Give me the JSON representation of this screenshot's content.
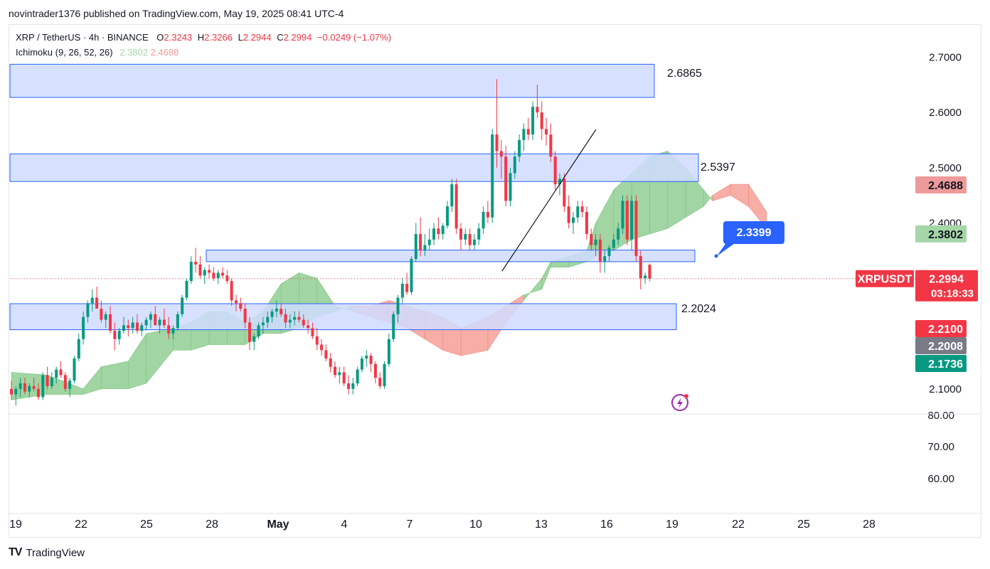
{
  "publish_line": "novintrader1376 published on TradingView.com, May 19, 2025 08:41 UTC-4",
  "symbol": {
    "name": "XRP / TetherUS · 4h · BINANCE",
    "o_label": "O",
    "o": "2.3243",
    "h_label": "H",
    "h": "2.3266",
    "l_label": "L",
    "l": "2.2944",
    "c_label": "C",
    "c": "2.2994",
    "change": "−0.0249 (−1.07%)"
  },
  "indicator": {
    "name": "Ichimoku (9, 26, 52, 26)",
    "value1": "2.3802",
    "value2": "2.4688"
  },
  "logo": {
    "mark": "TV",
    "name": "TradingView"
  },
  "colors": {
    "up": "#089981",
    "down": "#f23645",
    "zone_fill": "#d0dcff",
    "zone_border": "#2962ff",
    "cloud_bull": "#81c784",
    "cloud_bear": "#f28b82",
    "callout": "#2962ff"
  },
  "chart_data": {
    "type": "candlestick",
    "x_ticks": [
      "19",
      "22",
      "25",
      "28",
      "May",
      "4",
      "7",
      "10",
      "13",
      "16",
      "19",
      "22",
      "25",
      "28"
    ],
    "y_ticks": [
      "2.7000",
      "2.6000",
      "2.5000",
      "2.4000",
      "2.1000"
    ],
    "y_ticks_lower": [
      "80.00",
      "70.00",
      "60.00"
    ],
    "ylim": [
      2.05,
      2.74
    ],
    "resistance_zones": [
      {
        "low": 2.627,
        "high": 2.687,
        "label": "2.6865"
      },
      {
        "low": 2.475,
        "high": 2.525,
        "label": "2.5397"
      },
      {
        "low": 2.33,
        "high": 2.351
      },
      {
        "low": 2.207,
        "high": 2.254,
        "label": "2.2024"
      }
    ],
    "callout_label": "2.3399",
    "price_labels": [
      {
        "value": 2.4688,
        "text": "2.4688",
        "bg": "#ef9a9a",
        "fg": "#131722"
      },
      {
        "value": 2.3802,
        "text": "2.3802",
        "bg": "#a5d6a7",
        "fg": "#131722"
      },
      {
        "value": 2.2994,
        "text": "2.2994",
        "sub": "03:18:33",
        "bg": "#f23645",
        "fg": "#ffffff",
        "ticker": "XRPUSDT"
      },
      {
        "value": 2.21,
        "text": "2.2100",
        "bg": "#f23645",
        "fg": "#ffffff"
      },
      {
        "value": 2.2008,
        "text": "2.2008",
        "bg": "#787b86",
        "fg": "#ffffff"
      },
      {
        "value": 2.1736,
        "text": "2.1736",
        "bg": "#089981",
        "fg": "#ffffff"
      }
    ],
    "last_price": 2.2994,
    "ohlc": [
      [
        2.1,
        2.115,
        2.08,
        2.09
      ],
      [
        2.09,
        2.105,
        2.07,
        2.1
      ],
      [
        2.1,
        2.12,
        2.085,
        2.11
      ],
      [
        2.11,
        2.12,
        2.09,
        2.095
      ],
      [
        2.095,
        2.11,
        2.085,
        2.105
      ],
      [
        2.105,
        2.12,
        2.095,
        2.1
      ],
      [
        2.1,
        2.11,
        2.08,
        2.085
      ],
      [
        2.085,
        2.13,
        2.08,
        2.125
      ],
      [
        2.125,
        2.14,
        2.1,
        2.105
      ],
      [
        2.105,
        2.13,
        2.1,
        2.12
      ],
      [
        2.12,
        2.14,
        2.11,
        2.135
      ],
      [
        2.135,
        2.15,
        2.12,
        2.125
      ],
      [
        2.125,
        2.13,
        2.095,
        2.1
      ],
      [
        2.1,
        2.12,
        2.085,
        2.115
      ],
      [
        2.115,
        2.16,
        2.11,
        2.155
      ],
      [
        2.155,
        2.2,
        2.15,
        2.19
      ],
      [
        2.19,
        2.24,
        2.18,
        2.23
      ],
      [
        2.23,
        2.26,
        2.22,
        2.255
      ],
      [
        2.255,
        2.28,
        2.24,
        2.265
      ],
      [
        2.265,
        2.285,
        2.25,
        2.245
      ],
      [
        2.245,
        2.26,
        2.22,
        2.225
      ],
      [
        2.225,
        2.24,
        2.21,
        2.235
      ],
      [
        2.235,
        2.25,
        2.2,
        2.205
      ],
      [
        2.205,
        2.22,
        2.17,
        2.19
      ],
      [
        2.19,
        2.21,
        2.18,
        2.205
      ],
      [
        2.205,
        2.23,
        2.2,
        2.215
      ],
      [
        2.215,
        2.225,
        2.195,
        2.21
      ],
      [
        2.21,
        2.23,
        2.2,
        2.22
      ],
      [
        2.22,
        2.235,
        2.2,
        2.205
      ],
      [
        2.205,
        2.22,
        2.195,
        2.215
      ],
      [
        2.215,
        2.23,
        2.205,
        2.225
      ],
      [
        2.225,
        2.24,
        2.21,
        2.235
      ],
      [
        2.235,
        2.25,
        2.22,
        2.215
      ],
      [
        2.215,
        2.23,
        2.2,
        2.225
      ],
      [
        2.225,
        2.245,
        2.21,
        2.215
      ],
      [
        2.215,
        2.23,
        2.19,
        2.2
      ],
      [
        2.2,
        2.215,
        2.19,
        2.21
      ],
      [
        2.21,
        2.24,
        2.205,
        2.235
      ],
      [
        2.235,
        2.27,
        2.23,
        2.265
      ],
      [
        2.265,
        2.3,
        2.26,
        2.295
      ],
      [
        2.295,
        2.34,
        2.29,
        2.33
      ],
      [
        2.33,
        2.355,
        2.31,
        2.325
      ],
      [
        2.325,
        2.34,
        2.3,
        2.305
      ],
      [
        2.305,
        2.32,
        2.29,
        2.315
      ],
      [
        2.315,
        2.325,
        2.3,
        2.31
      ],
      [
        2.31,
        2.32,
        2.295,
        2.3
      ],
      [
        2.3,
        2.315,
        2.29,
        2.31
      ],
      [
        2.31,
        2.32,
        2.3,
        2.305
      ],
      [
        2.305,
        2.315,
        2.29,
        2.295
      ],
      [
        2.295,
        2.3,
        2.25,
        2.26
      ],
      [
        2.26,
        2.27,
        2.24,
        2.255
      ],
      [
        2.255,
        2.265,
        2.24,
        2.245
      ],
      [
        2.245,
        2.255,
        2.21,
        2.22
      ],
      [
        2.22,
        2.23,
        2.17,
        2.185
      ],
      [
        2.185,
        2.2,
        2.17,
        2.195
      ],
      [
        2.195,
        2.22,
        2.19,
        2.215
      ],
      [
        2.215,
        2.23,
        2.2,
        2.22
      ],
      [
        2.22,
        2.24,
        2.21,
        2.23
      ],
      [
        2.23,
        2.245,
        2.22,
        2.24
      ],
      [
        2.24,
        2.26,
        2.23,
        2.245
      ],
      [
        2.245,
        2.255,
        2.23,
        2.235
      ],
      [
        2.235,
        2.245,
        2.21,
        2.22
      ],
      [
        2.22,
        2.235,
        2.21,
        2.225
      ],
      [
        2.225,
        2.24,
        2.215,
        2.23
      ],
      [
        2.23,
        2.24,
        2.22,
        2.225
      ],
      [
        2.225,
        2.235,
        2.21,
        2.215
      ],
      [
        2.215,
        2.225,
        2.2,
        2.21
      ],
      [
        2.21,
        2.22,
        2.19,
        2.195
      ],
      [
        2.195,
        2.21,
        2.17,
        2.18
      ],
      [
        2.18,
        2.19,
        2.16,
        2.17
      ],
      [
        2.17,
        2.18,
        2.15,
        2.155
      ],
      [
        2.155,
        2.165,
        2.13,
        2.14
      ],
      [
        2.14,
        2.15,
        2.12,
        2.125
      ],
      [
        2.125,
        2.14,
        2.11,
        2.13
      ],
      [
        2.13,
        2.14,
        2.105,
        2.11
      ],
      [
        2.11,
        2.125,
        2.09,
        2.1
      ],
      [
        2.1,
        2.12,
        2.09,
        2.11
      ],
      [
        2.11,
        2.14,
        2.105,
        2.135
      ],
      [
        2.135,
        2.16,
        2.13,
        2.155
      ],
      [
        2.155,
        2.17,
        2.14,
        2.16
      ],
      [
        2.16,
        2.165,
        2.13,
        2.145
      ],
      [
        2.145,
        2.15,
        2.11,
        2.12
      ],
      [
        2.12,
        2.13,
        2.1,
        2.105
      ],
      [
        2.105,
        2.15,
        2.1,
        2.145
      ],
      [
        2.145,
        2.2,
        2.14,
        2.19
      ],
      [
        2.19,
        2.24,
        2.185,
        2.235
      ],
      [
        2.235,
        2.27,
        2.22,
        2.265
      ],
      [
        2.265,
        2.3,
        2.255,
        2.29
      ],
      [
        2.29,
        2.31,
        2.27,
        2.275
      ],
      [
        2.275,
        2.34,
        2.27,
        2.335
      ],
      [
        2.335,
        2.4,
        2.33,
        2.38
      ],
      [
        2.38,
        2.41,
        2.34,
        2.35
      ],
      [
        2.35,
        2.38,
        2.34,
        2.36
      ],
      [
        2.36,
        2.39,
        2.35,
        2.37
      ],
      [
        2.37,
        2.4,
        2.36,
        2.39
      ],
      [
        2.39,
        2.41,
        2.37,
        2.38
      ],
      [
        2.38,
        2.4,
        2.37,
        2.395
      ],
      [
        2.395,
        2.44,
        2.39,
        2.43
      ],
      [
        2.43,
        2.48,
        2.42,
        2.47
      ],
      [
        2.47,
        2.48,
        2.38,
        2.39
      ],
      [
        2.39,
        2.4,
        2.35,
        2.37
      ],
      [
        2.37,
        2.39,
        2.36,
        2.38
      ],
      [
        2.38,
        2.39,
        2.35,
        2.36
      ],
      [
        2.36,
        2.38,
        2.35,
        2.37
      ],
      [
        2.37,
        2.4,
        2.36,
        2.39
      ],
      [
        2.39,
        2.43,
        2.38,
        2.42
      ],
      [
        2.42,
        2.44,
        2.4,
        2.41
      ],
      [
        2.41,
        2.57,
        2.4,
        2.56
      ],
      [
        2.56,
        2.66,
        2.5,
        2.53
      ],
      [
        2.53,
        2.55,
        2.48,
        2.52
      ],
      [
        2.52,
        2.54,
        2.43,
        2.44
      ],
      [
        2.44,
        2.5,
        2.43,
        2.49
      ],
      [
        2.49,
        2.53,
        2.48,
        2.52
      ],
      [
        2.52,
        2.56,
        2.51,
        2.55
      ],
      [
        2.55,
        2.58,
        2.53,
        2.57
      ],
      [
        2.57,
        2.59,
        2.55,
        2.56
      ],
      [
        2.56,
        2.62,
        2.55,
        2.61
      ],
      [
        2.61,
        2.65,
        2.59,
        2.6
      ],
      [
        2.6,
        2.62,
        2.55,
        2.57
      ],
      [
        2.57,
        2.59,
        2.54,
        2.56
      ],
      [
        2.56,
        2.58,
        2.51,
        2.52
      ],
      [
        2.52,
        2.53,
        2.46,
        2.47
      ],
      [
        2.47,
        2.49,
        2.45,
        2.48
      ],
      [
        2.48,
        2.49,
        2.42,
        2.43
      ],
      [
        2.43,
        2.45,
        2.39,
        2.4
      ],
      [
        2.4,
        2.42,
        2.38,
        2.41
      ],
      [
        2.41,
        2.44,
        2.4,
        2.43
      ],
      [
        2.43,
        2.44,
        2.41,
        2.42
      ],
      [
        2.42,
        2.43,
        2.37,
        2.38
      ],
      [
        2.38,
        2.39,
        2.35,
        2.36
      ],
      [
        2.36,
        2.38,
        2.34,
        2.37
      ],
      [
        2.37,
        2.38,
        2.31,
        2.33
      ],
      [
        2.33,
        2.35,
        2.31,
        2.34
      ],
      [
        2.34,
        2.36,
        2.33,
        2.355
      ],
      [
        2.355,
        2.38,
        2.35,
        2.37
      ],
      [
        2.37,
        2.4,
        2.36,
        2.39
      ],
      [
        2.39,
        2.45,
        2.38,
        2.44
      ],
      [
        2.44,
        2.45,
        2.36,
        2.37
      ],
      [
        2.37,
        2.45,
        2.35,
        2.44
      ],
      [
        2.44,
        2.45,
        2.33,
        2.34
      ],
      [
        2.34,
        2.35,
        2.28,
        2.3
      ],
      [
        2.3,
        2.31,
        2.29,
        2.305
      ],
      [
        2.3243,
        2.3266,
        2.2944,
        2.2994
      ]
    ],
    "cloud_points": {
      "span_a": [
        [
          0,
          2.13
        ],
        [
          8,
          2.125
        ],
        [
          16,
          2.1
        ],
        [
          20,
          2.14
        ],
        [
          26,
          2.15
        ],
        [
          30,
          2.2
        ],
        [
          36,
          2.21
        ],
        [
          40,
          2.22
        ],
        [
          44,
          2.24
        ],
        [
          48,
          2.24
        ],
        [
          52,
          2.22
        ],
        [
          56,
          2.24
        ],
        [
          60,
          2.29
        ],
        [
          64,
          2.31
        ],
        [
          68,
          2.3
        ],
        [
          72,
          2.25
        ],
        [
          76,
          2.24
        ],
        [
          80,
          2.23
        ],
        [
          84,
          2.22
        ],
        [
          88,
          2.21
        ],
        [
          92,
          2.19
        ],
        [
          96,
          2.17
        ],
        [
          100,
          2.16
        ],
        [
          106,
          2.17
        ],
        [
          110,
          2.22
        ],
        [
          114,
          2.26
        ],
        [
          118,
          2.3
        ],
        [
          120,
          2.33
        ],
        [
          124,
          2.34
        ],
        [
          128,
          2.35
        ],
        [
          130,
          2.4
        ],
        [
          134,
          2.46
        ],
        [
          138,
          2.49
        ],
        [
          142,
          2.52
        ],
        [
          146,
          2.53
        ],
        [
          150,
          2.5
        ],
        [
          154,
          2.46
        ],
        [
          156,
          2.44
        ],
        [
          160,
          2.45
        ],
        [
          164,
          2.43
        ],
        [
          168,
          2.39
        ]
      ],
      "span_b": [
        [
          0,
          2.08
        ],
        [
          8,
          2.09
        ],
        [
          16,
          2.09
        ],
        [
          20,
          2.1
        ],
        [
          26,
          2.1
        ],
        [
          30,
          2.11
        ],
        [
          36,
          2.17
        ],
        [
          40,
          2.17
        ],
        [
          44,
          2.18
        ],
        [
          48,
          2.18
        ],
        [
          52,
          2.18
        ],
        [
          56,
          2.2
        ],
        [
          60,
          2.2
        ],
        [
          64,
          2.21
        ],
        [
          68,
          2.23
        ],
        [
          72,
          2.24
        ],
        [
          76,
          2.25
        ],
        [
          80,
          2.25
        ],
        [
          84,
          2.26
        ],
        [
          88,
          2.25
        ],
        [
          92,
          2.24
        ],
        [
          96,
          2.23
        ],
        [
          100,
          2.21
        ],
        [
          106,
          2.23
        ],
        [
          110,
          2.25
        ],
        [
          114,
          2.27
        ],
        [
          118,
          2.28
        ],
        [
          120,
          2.32
        ],
        [
          124,
          2.32
        ],
        [
          128,
          2.33
        ],
        [
          130,
          2.34
        ],
        [
          134,
          2.35
        ],
        [
          138,
          2.37
        ],
        [
          142,
          2.38
        ],
        [
          146,
          2.39
        ],
        [
          150,
          2.41
        ],
        [
          154,
          2.43
        ],
        [
          156,
          2.45
        ],
        [
          160,
          2.47
        ],
        [
          164,
          2.47
        ],
        [
          168,
          2.42
        ]
      ]
    }
  }
}
